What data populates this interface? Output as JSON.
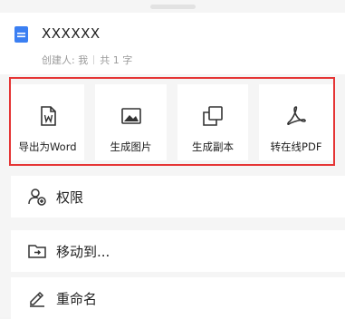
{
  "document": {
    "title": "XXXXXX",
    "creator_label": "创建人: 我",
    "char_count": "共 1 字",
    "icon": "blue-document-icon"
  },
  "actions": [
    {
      "label": "导出为Word",
      "icon": "word-file-icon"
    },
    {
      "label": "生成图片",
      "icon": "image-icon"
    },
    {
      "label": "生成副本",
      "icon": "copy-icon"
    },
    {
      "label": "转在线PDF",
      "icon": "pdf-icon"
    }
  ],
  "menu": [
    {
      "label": "权限",
      "icon": "user-permission-icon"
    },
    {
      "label": "移动到...",
      "icon": "move-folder-icon"
    },
    {
      "label": "重命名",
      "icon": "rename-pen-icon"
    }
  ],
  "colors": {
    "highlight_border": "#e53535",
    "doc_icon_blue": "#3b7ff2"
  }
}
